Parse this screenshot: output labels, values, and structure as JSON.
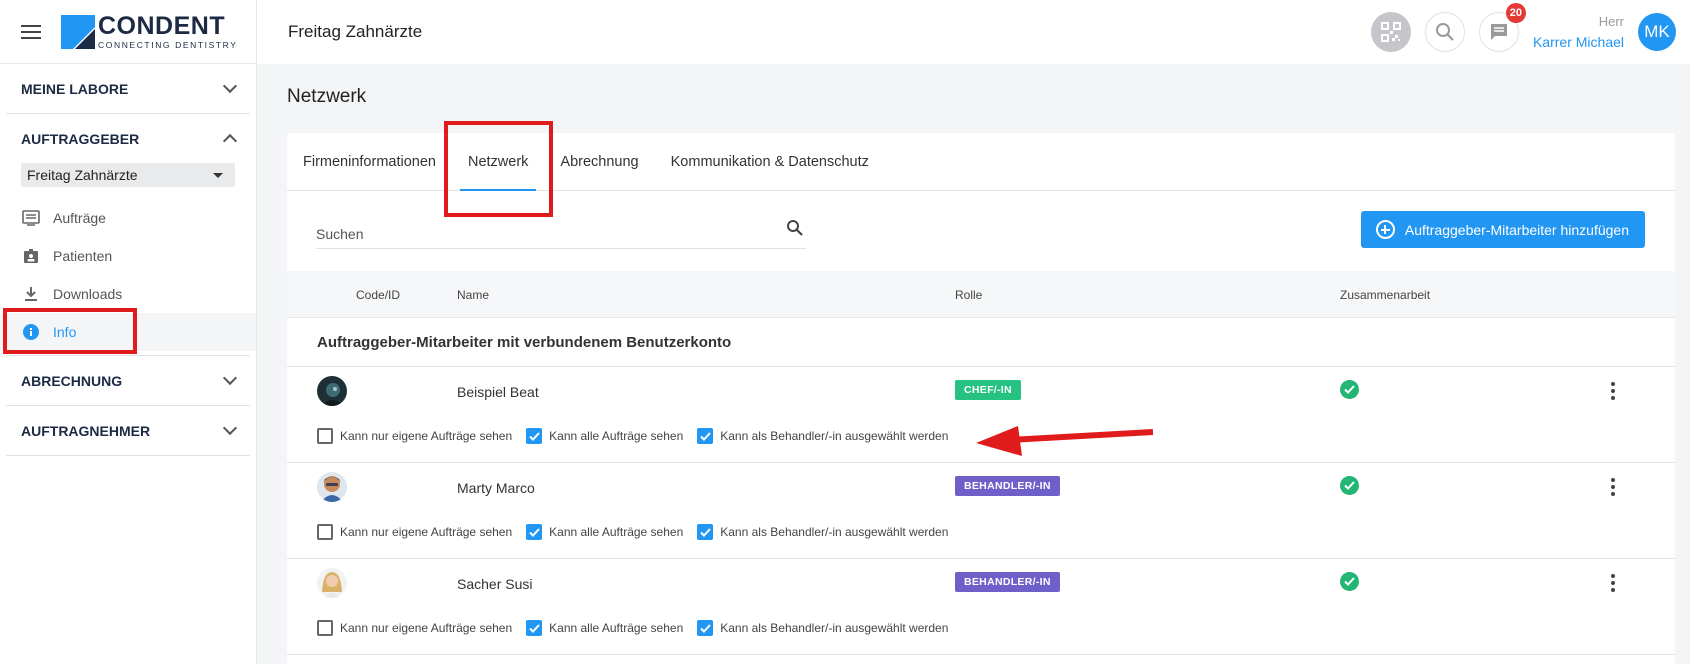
{
  "brand": {
    "name": "CONDENT",
    "tagline": "CONNECTING DENTISTRY"
  },
  "header": {
    "title": "Freitag Zahnärzte",
    "notifications_count": "20",
    "user_salutation": "Herr",
    "user_name": "Karrer Michael",
    "user_initials": "MK"
  },
  "sidebar": {
    "sections": [
      {
        "label": "MEINE LABORE",
        "expanded": false
      },
      {
        "label": "AUFTRAGGEBER",
        "expanded": true
      },
      {
        "label": "ABRECHNUNG",
        "expanded": false
      },
      {
        "label": "AUFTRAGNEHMER",
        "expanded": false
      }
    ],
    "client_select": "Freitag Zahnärzte",
    "items": [
      {
        "label": "Aufträge",
        "icon": "list-icon"
      },
      {
        "label": "Patienten",
        "icon": "id-badge-icon"
      },
      {
        "label": "Downloads",
        "icon": "download-icon"
      },
      {
        "label": "Info",
        "icon": "info-icon",
        "active": true
      }
    ]
  },
  "main": {
    "page_title": "Netzwerk",
    "tabs": [
      {
        "label": "Firmeninformationen"
      },
      {
        "label": "Netzwerk",
        "active": true
      },
      {
        "label": "Abrechnung"
      },
      {
        "label": "Kommunikation & Datenschutz"
      }
    ],
    "search": {
      "placeholder": "Suchen"
    },
    "add_button_label": "Auftraggeber-Mitarbeiter hinzufügen",
    "columns": [
      "Code/ID",
      "Name",
      "Rolle",
      "Zusammenarbeit"
    ],
    "group_heading": "Auftraggeber-Mitarbeiter mit verbundenem Benutzerkonto",
    "permission_labels": [
      "Kann nur eigene Aufträge sehen",
      "Kann alle Aufträge sehen",
      "Kann als Behandler/-in ausgewählt werden"
    ],
    "rows": [
      {
        "name": "Beispiel Beat",
        "role": "CHEF/-IN",
        "role_color": "#26c281",
        "collaboration": true,
        "perms": [
          false,
          true,
          true
        ]
      },
      {
        "name": "Marty Marco",
        "role": "BEHANDLER/-IN",
        "role_color": "#6f5fc8",
        "collaboration": true,
        "perms": [
          false,
          true,
          true
        ]
      },
      {
        "name": "Sacher Susi",
        "role": "BEHANDLER/-IN",
        "role_color": "#6f5fc8",
        "collaboration": true,
        "perms": [
          false,
          true,
          true
        ]
      }
    ]
  },
  "colors": {
    "accent": "#2196f3",
    "annotation_red": "#e01b1b",
    "success": "#22b573"
  }
}
